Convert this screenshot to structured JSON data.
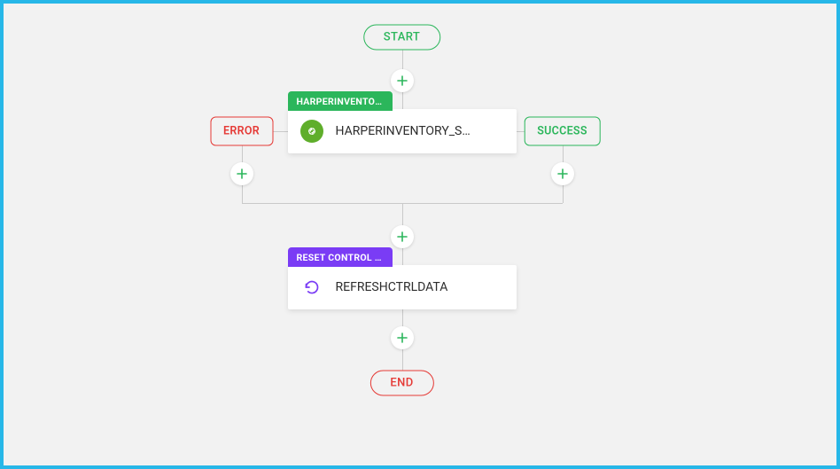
{
  "colors": {
    "green": "#2BB65B",
    "red": "#E53935",
    "purple": "#7A3CF5",
    "api_green": "#5FAE2B",
    "frame_blue": "#27B7E8"
  },
  "start": {
    "label": "START"
  },
  "end": {
    "label": "END"
  },
  "error": {
    "label": "ERROR"
  },
  "success": {
    "label": "SUCCESS"
  },
  "node1": {
    "tag": "HARPERINVENTOR…",
    "title": "HARPERINVENTORY_S…",
    "icon": "api-icon"
  },
  "node2": {
    "tag": "RESET CONTROL D…",
    "title": "REFRESHCTRLDATA",
    "icon": "refresh-icon"
  }
}
